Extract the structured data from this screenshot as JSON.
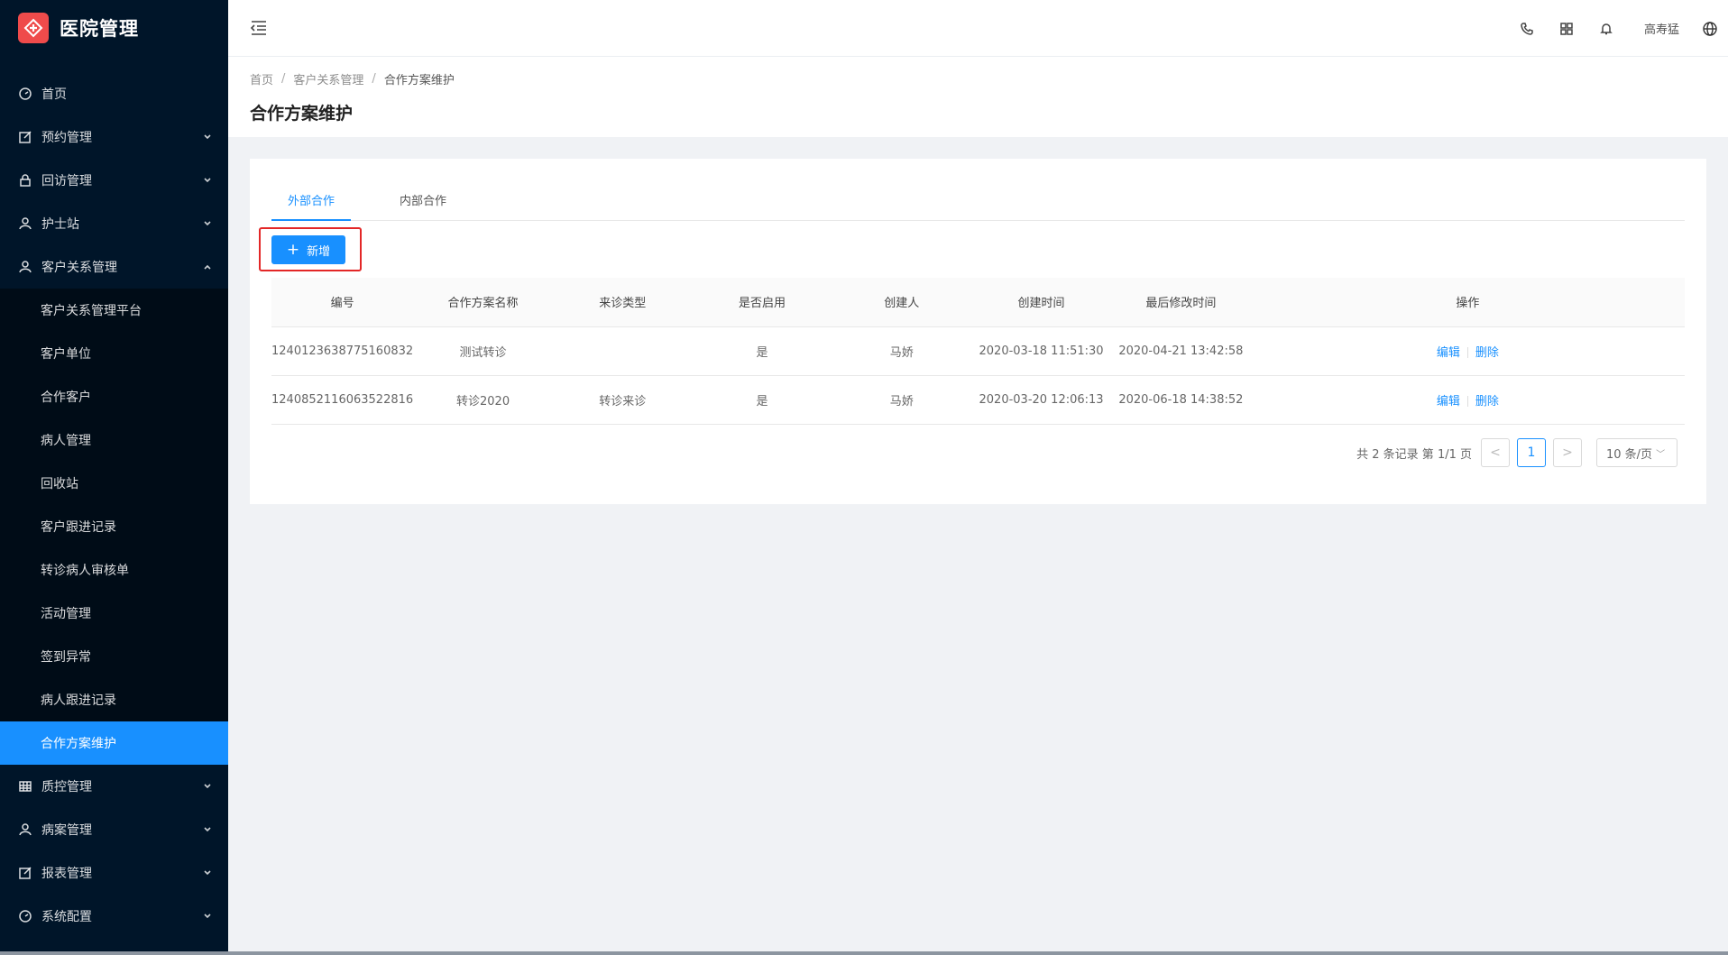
{
  "app": {
    "title": "医院管理"
  },
  "sidebar": {
    "items": [
      {
        "label": "首页",
        "icon": "dashboard-icon",
        "has_arrow": false
      },
      {
        "label": "预约管理",
        "icon": "edit-icon",
        "has_arrow": true
      },
      {
        "label": "回访管理",
        "icon": "lock-icon",
        "has_arrow": true
      },
      {
        "label": "护士站",
        "icon": "user-icon",
        "has_arrow": true
      },
      {
        "label": "客户关系管理",
        "icon": "user-icon",
        "has_arrow": true,
        "expanded": true
      }
    ],
    "submenu": [
      {
        "label": "客户关系管理平台"
      },
      {
        "label": "客户单位"
      },
      {
        "label": "合作客户"
      },
      {
        "label": "病人管理"
      },
      {
        "label": "回收站"
      },
      {
        "label": "客户跟进记录"
      },
      {
        "label": "转诊病人审核单"
      },
      {
        "label": "活动管理"
      },
      {
        "label": "签到异常"
      },
      {
        "label": "病人跟进记录"
      },
      {
        "label": "合作方案维护",
        "active": true
      }
    ],
    "items_after": [
      {
        "label": "质控管理",
        "icon": "table-icon"
      },
      {
        "label": "病案管理",
        "icon": "user-icon"
      },
      {
        "label": "报表管理",
        "icon": "edit-icon"
      },
      {
        "label": "系统配置",
        "icon": "dashboard-icon"
      }
    ]
  },
  "header": {
    "user": "高寿猛",
    "icons": [
      "phone-icon",
      "grid-icon",
      "bell-icon",
      "globe-icon"
    ]
  },
  "breadcrumb": [
    "首页",
    "客户关系管理",
    "合作方案维护"
  ],
  "page_title": "合作方案维护",
  "tabs": [
    {
      "label": "外部合作",
      "active": true
    },
    {
      "label": "内部合作",
      "active": false
    }
  ],
  "add_button": "新增",
  "table": {
    "columns": [
      "编号",
      "合作方案名称",
      "来诊类型",
      "是否启用",
      "创建人",
      "创建时间",
      "最后修改时间",
      "操作"
    ],
    "rows": [
      [
        "1240123638775160832",
        "测试转诊",
        "",
        "是",
        "马娇",
        "2020-03-18 11:51:30",
        "2020-04-21 13:42:58"
      ],
      [
        "1240852116063522816",
        "转诊2020",
        "转诊来诊",
        "是",
        "马娇",
        "2020-03-20 12:06:13",
        "2020-06-18 14:38:52"
      ]
    ],
    "actions": {
      "edit": "编辑",
      "delete": "删除"
    }
  },
  "pagination": {
    "total_text": "共 2 条记录 第 1/1 页",
    "current_page": "1",
    "prev": "<",
    "next": ">",
    "page_size": "10 条/页"
  },
  "colors": {
    "primary": "#1890ff",
    "sidebar": "#001529",
    "highlight_border": "#e32727",
    "logo": "#ef4b4b"
  }
}
